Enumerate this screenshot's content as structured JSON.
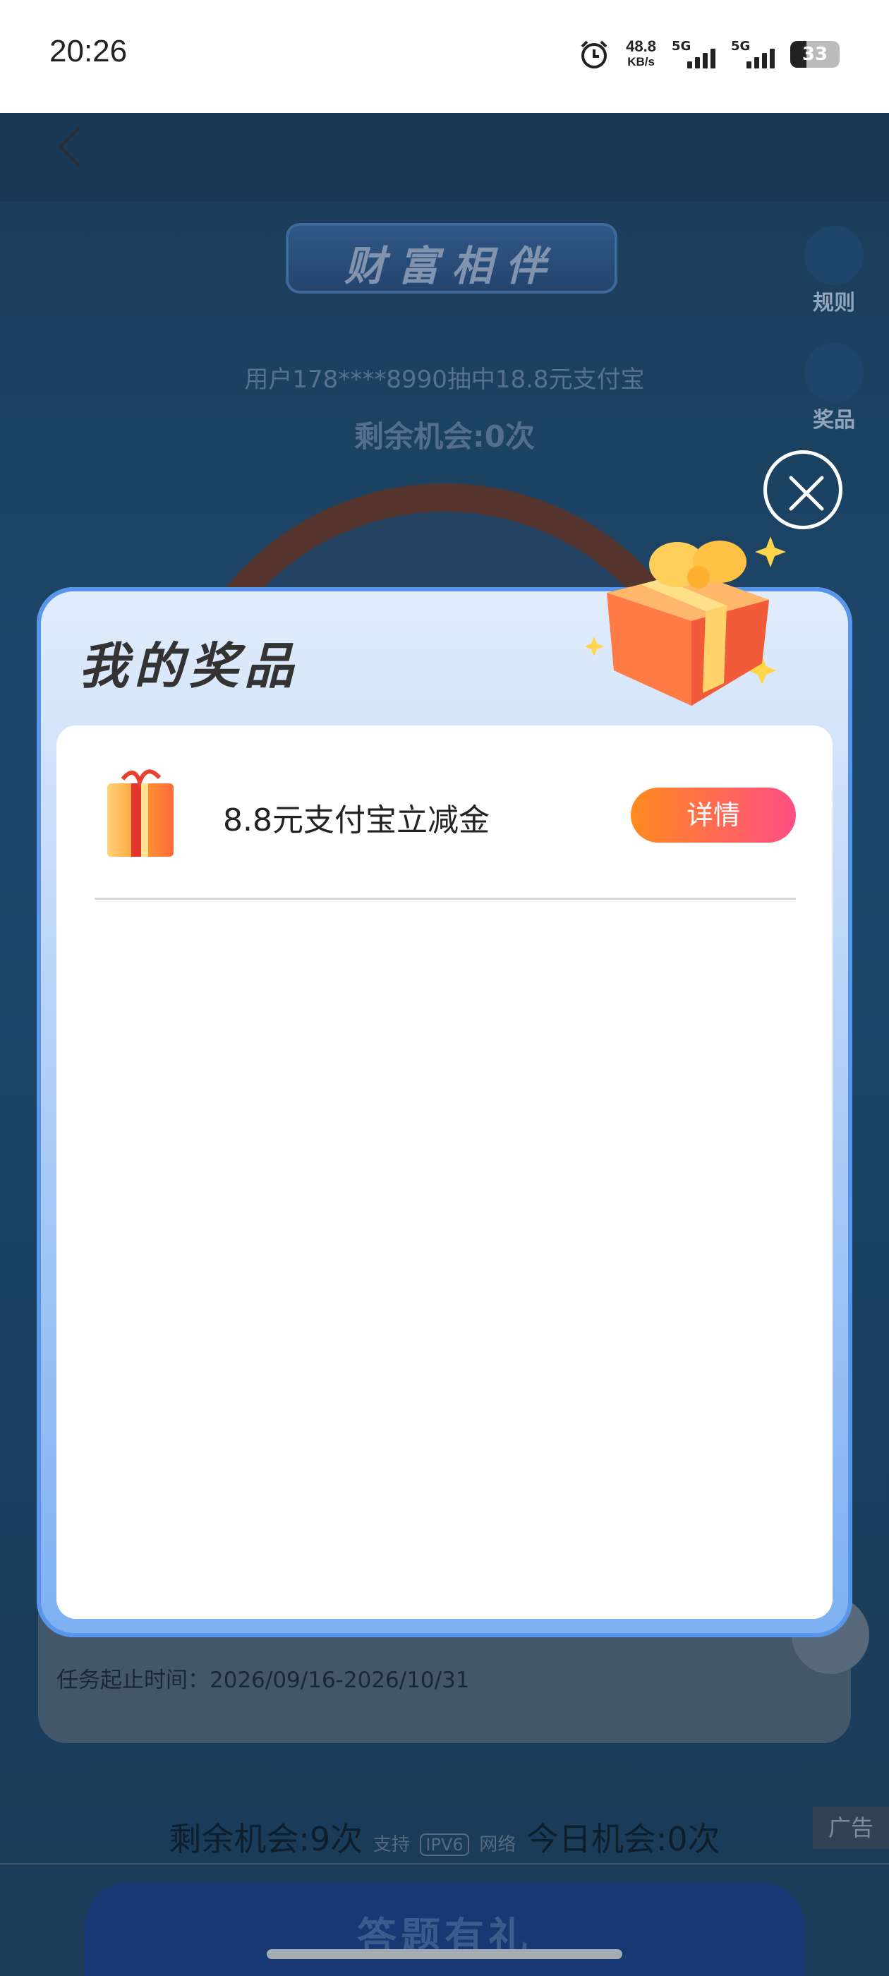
{
  "status_bar": {
    "time": "20:26",
    "speed_value": "48.8",
    "speed_unit": "KB/s",
    "network1": "5G",
    "network2": "5G",
    "battery": "33"
  },
  "background": {
    "banner_text": "财富相伴",
    "side_rules_label": "规则",
    "side_prizes_label": "奖品",
    "ticker_line": "用户178****8990抽中18.8元支付宝",
    "remaining_top": "剩余机会:0次",
    "task_period": "任务起止时间：2026/09/16-2026/10/31",
    "remaining_bottom": "剩余机会:9次",
    "ipv6_prefix": "支持",
    "ipv6_badge": "IPV6",
    "ipv6_suffix": "网络",
    "today_chance": "今日机会:0次",
    "ad_label": "广告",
    "footer_button": "答题有礼"
  },
  "modal": {
    "title": "我的奖品",
    "prizes": [
      {
        "name": "8.8元支付宝立减金",
        "action_label": "详情"
      }
    ]
  },
  "colors": {
    "accent_gradient_start": "#ff8a1f",
    "accent_gradient_end": "#ff4e83",
    "modal_border": "#5896ec"
  }
}
